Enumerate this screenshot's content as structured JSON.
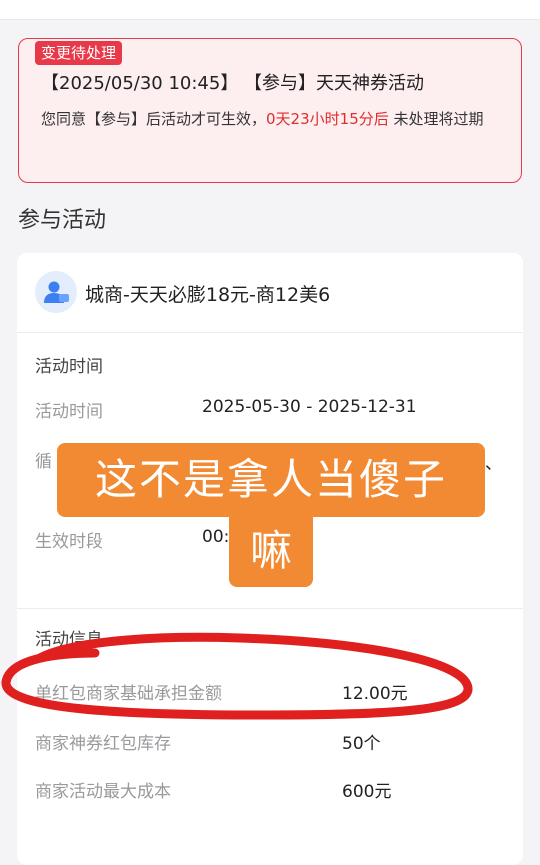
{
  "alert": {
    "tag": "变更待处理",
    "headline": "【2025/05/30 10:45】 【参与】天天神券活动",
    "notice_prefix": "您同意【参与】后活动才可生效，",
    "notice_countdown": "0天23小时15分后",
    "notice_suffix": " 未处理将过期"
  },
  "section_title": "参与活动",
  "merchant": {
    "avatar_icon": "user-badge-icon",
    "name": "城商-天天必膨18元-商12美6"
  },
  "activity_time": {
    "group_title": "活动时间",
    "time_label": "活动时间",
    "time_value": "2025-05-30 - 2025-12-31",
    "cycle_label_partial": "循",
    "cycle_value_partial": "、",
    "effective_label": "生效时段",
    "effective_value_partial": "00:"
  },
  "activity_info": {
    "group_title": "活动信息",
    "rows": [
      {
        "label": "单红包商家基础承担金额",
        "value": "12.00元"
      },
      {
        "label": "商家神券红包库存",
        "value": "50个"
      },
      {
        "label": "商家活动最大成本",
        "value": "600元"
      }
    ]
  },
  "overlay": {
    "line1": "这不是拿人当傻子",
    "line2": "嘛"
  },
  "colors": {
    "alert_red": "#e8394a",
    "highlight_red": "#e02d2d",
    "sticker_orange": "#f28a33",
    "annotation_red": "#e01f1f"
  }
}
